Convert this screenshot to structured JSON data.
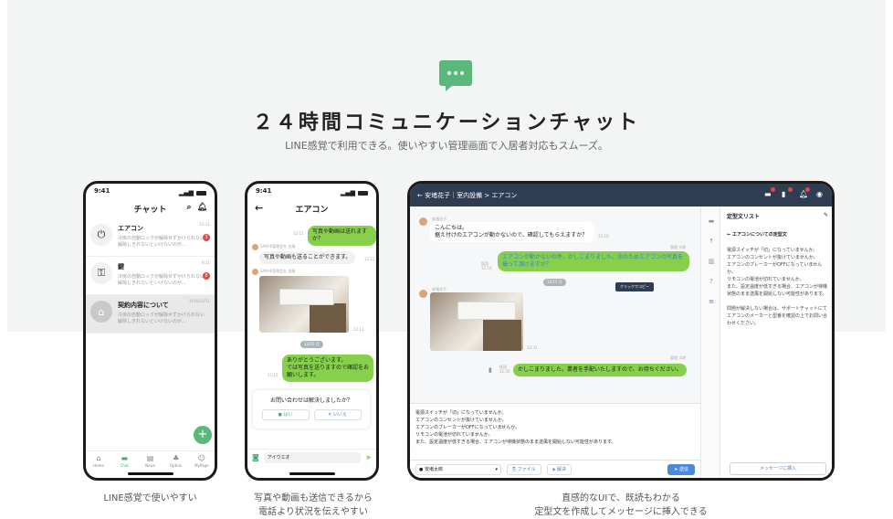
{
  "hero": {
    "title": "２４時間コミュニケーションチャット",
    "subtitle": "LINE感覚で利用できる。使いやすい管理画面で入居者対応もスムーズ。",
    "icon": "chat-bubble-icon",
    "accent": "#5ab87a"
  },
  "phone1": {
    "time": "9:41",
    "title": "チャット",
    "chats": [
      {
        "name": "エアコン",
        "preview": "冷房の自動ロックが解除せずかけられない 解除しきれないといけないのが...",
        "time": "12:11",
        "badge": "3",
        "icon": "plug-icon"
      },
      {
        "name": "鍵",
        "preview": "冷房の自動ロックが解除せずかけられない 解除しきれないといけないのが...",
        "time": "8:31",
        "badge": "8",
        "icon": "key-icon"
      },
      {
        "name": "契約内容について",
        "preview": "冷房の自動ロックが解除せずかけられない 解除しきれないといけないのが...",
        "time": "2016/12/11",
        "badge": "",
        "icon": "house-icon"
      }
    ],
    "tabs": [
      "Home",
      "Chat",
      "News",
      "Option",
      "MyPage"
    ]
  },
  "phone2": {
    "time": "9:41",
    "title": "エアコン",
    "msg_me_1": "写真や動画は送れますか？",
    "time_1": "12:11",
    "sender": "SAKAE管理会社 佐藤",
    "msg_them_1": "写真や動画も送ることができます。",
    "time_2": "12:11",
    "sender_2": "SAKAE管理会社 佐藤",
    "photo_time": "12:11",
    "date_pill": "12/15 月",
    "msg_me_2": "ありがとうございます。\nでは写真を送りますので確認をお願いします。",
    "time_3": "12:15",
    "question": "お問い合わせは解決しましたか？",
    "yes": "はい",
    "no": "いいえ",
    "input_value": "アイウエオ"
  },
  "tablet": {
    "breadcrumb": "安堵花子｜室内設備 > エアコン",
    "sender": "安堵花子",
    "msg_them_1": "こんにちは。\n据え付けのエアコンが動かないので、確認してもらえますか？",
    "time_1": "12:10",
    "staff": "管理 太郎",
    "read_1": "既読",
    "time_2": "12:10",
    "msg_me_1": "エアコンが動かないの件、かしこまりました。念のためエアコンの写真を撮って頂けますか？",
    "date_pill": "12/15 月",
    "tooltip": "クリックでコピー",
    "sender_2": "安堵花子",
    "photo_time": "12:31",
    "staff_2": "管理 太郎",
    "read_2": "既読",
    "time_3": "12:35",
    "msg_me_2": "かしこまりました。業者を手配いたしますので、お待ちください。",
    "compose": "電源スイッチが「切」になっていませんか。\nエアコンのコンセントが抜けていませんか。\nエアコンのブレーカーがOFFになっていませんか。\nリモコンの電池が切れていませんか。\nまた、設定温度が低すぎる場合、エアコンが待機状態のまま送風を開始しない可能性があります。",
    "user_select": "安堵太郎",
    "file_btn": "ファイル",
    "resolve_btn": "解決",
    "send_btn": "送信",
    "panel_title": "定型文リスト",
    "panel_sub": "エアコンについての定型文",
    "panel_body": "電源スイッチが「切」になっていませんか。\nエアコンのコンセントが抜けていませんか。\nエアコンのブレーカーがOFFになっていませんか。\nリモコンの電池が切れていませんか。\nまた、設定温度が低すぎる場合、エアコンが待機状態のまま送風を開始しない可能性があります。\n\n問題が解決しない場合は、サポートチャットにてエアコンのメーカーと型番を確認の上でお問い合わせください。",
    "insert_btn": "メッセージに挿入"
  },
  "captions": {
    "c1": "LINE感覚で使いやすい",
    "c2a": "写真や動画も送信できるから",
    "c2b": "電話より状況を伝えやすい",
    "c3a": "直感的なUIで、既読もわかる",
    "c3b": "定型文を作成してメッセージに挿入できる"
  }
}
